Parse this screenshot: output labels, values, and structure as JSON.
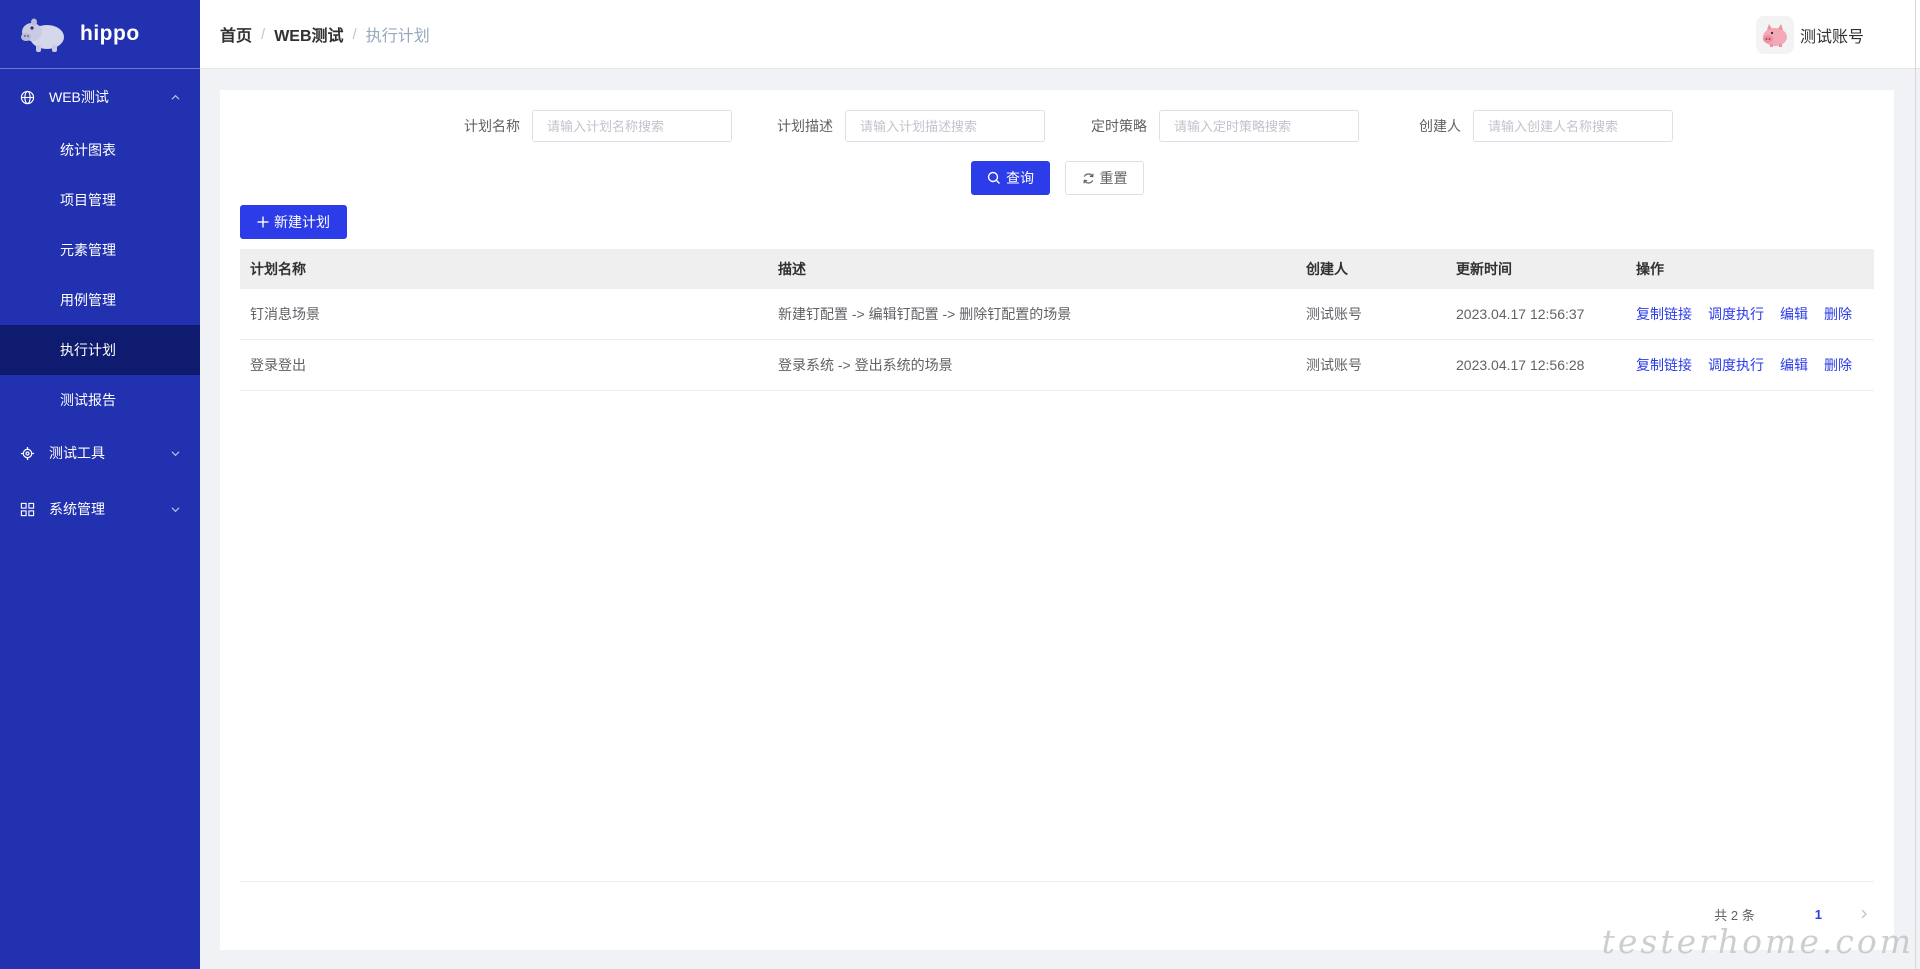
{
  "app": {
    "name": "hippo"
  },
  "sidebar": {
    "groups": [
      {
        "label": "WEB测试",
        "icon": "globe-icon",
        "expanded": true,
        "items": [
          {
            "label": "统计图表"
          },
          {
            "label": "项目管理"
          },
          {
            "label": "元素管理"
          },
          {
            "label": "用例管理"
          },
          {
            "label": "执行计划",
            "active": true
          },
          {
            "label": "测试报告"
          }
        ]
      },
      {
        "label": "测试工具",
        "icon": "gear-icon",
        "expanded": false
      },
      {
        "label": "系统管理",
        "icon": "grid-icon",
        "expanded": false
      }
    ]
  },
  "header": {
    "breadcrumb": [
      "首页",
      "WEB测试",
      "执行计划"
    ],
    "user": "测试账号"
  },
  "filters": [
    {
      "label": "计划名称",
      "placeholder": "请输入计划名称搜索"
    },
    {
      "label": "计划描述",
      "placeholder": "请输入计划描述搜索"
    },
    {
      "label": "定时策略",
      "placeholder": "请输入定时策略搜索"
    },
    {
      "label": "创建人",
      "placeholder": "请输入创建人名称搜索"
    }
  ],
  "buttons": {
    "search": "查询",
    "reset": "重置",
    "create": "新建计划"
  },
  "table": {
    "columns": [
      "计划名称",
      "描述",
      "创建人",
      "更新时间",
      "操作"
    ],
    "rows": [
      {
        "name": "钉消息场景",
        "desc": "新建钉配置 -> 编辑钉配置 -> 删除钉配置的场景",
        "creator": "测试账号",
        "updated": "2023.04.17 12:56:37"
      },
      {
        "name": "登录登出",
        "desc": "登录系统 -> 登出系统的场景",
        "creator": "测试账号",
        "updated": "2023.04.17 12:56:28"
      }
    ],
    "actions": [
      "复制链接",
      "调度执行",
      "编辑",
      "删除"
    ]
  },
  "pagination": {
    "total": "共 2 条",
    "current": "1"
  },
  "watermark": "testerhome.com",
  "colors": {
    "sidebar": "#2231b0",
    "sidebar_active": "#0f1b6e",
    "primary": "#2b3ce8"
  }
}
